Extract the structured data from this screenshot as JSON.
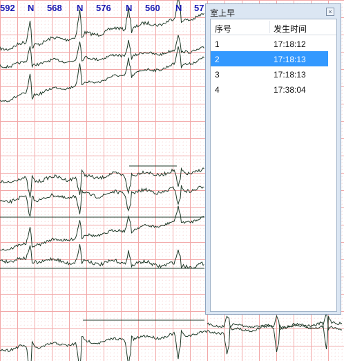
{
  "rr_labels": [
    "592",
    "N",
    "568",
    "N",
    "576",
    "N",
    "560",
    "N",
    "57"
  ],
  "colors": {
    "grid_major": "#f2a8a8",
    "grid_minor": "#f6c9c9",
    "trace": "#1f3a28",
    "label": "#1a1ab4",
    "selection": "#3399ff"
  },
  "popup": {
    "title": "室上早",
    "close_icon": "close-icon",
    "columns": [
      "序号",
      "发生时间"
    ],
    "rows": [
      {
        "index": "1",
        "time": "17:18:12"
      },
      {
        "index": "2",
        "time": "17:18:13"
      },
      {
        "index": "3",
        "time": "17:18:13"
      },
      {
        "index": "4",
        "time": "17:38:04"
      }
    ],
    "selected_row": 1
  }
}
